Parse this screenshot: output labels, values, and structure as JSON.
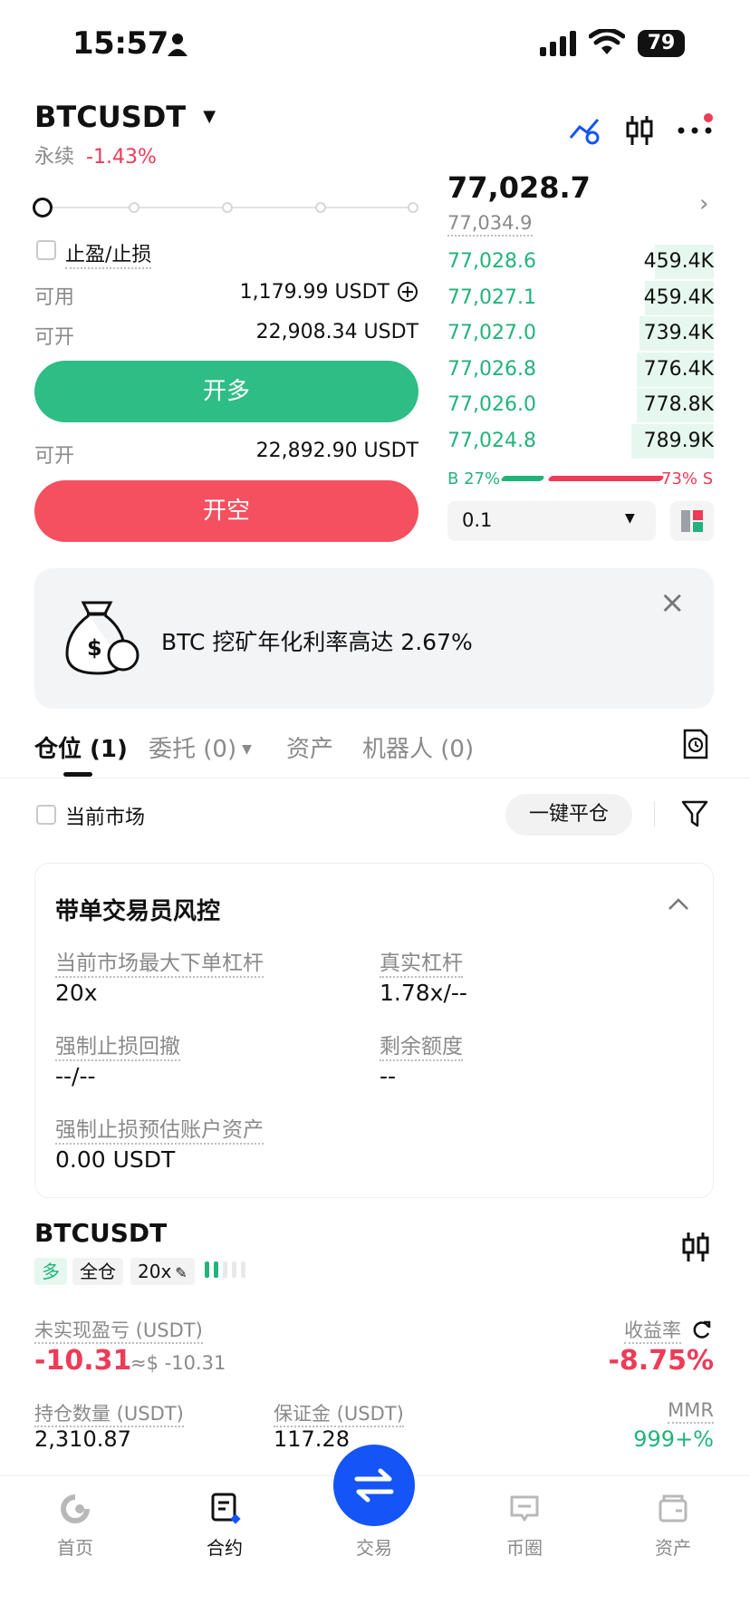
{
  "status_bar": {
    "time": "15:57",
    "battery": "79"
  },
  "header": {
    "pair": "BTCUSDT",
    "contract_type": "永续",
    "change": "-1.43%"
  },
  "order_form": {
    "tp_sl_label": "止盈/止损",
    "available_label": "可用",
    "available_value": "1,179.99 USDT",
    "open_label_1": "可开",
    "open_value_1": "22,908.34 USDT",
    "long_button": "开多",
    "open_label_2": "可开",
    "open_value_2": "22,892.90 USDT",
    "short_button": "开空"
  },
  "orderbook": {
    "last_price": "77,028.7",
    "mark_price": "77,034.9",
    "bids": [
      {
        "price": "77,028.6",
        "size": "459.4K",
        "depth": 0.22
      },
      {
        "price": "77,027.1",
        "size": "459.4K",
        "depth": 0.26
      },
      {
        "price": "77,027.0",
        "size": "739.4K",
        "depth": 0.28
      },
      {
        "price": "77,026.8",
        "size": "776.4K",
        "depth": 0.29
      },
      {
        "price": "77,026.0",
        "size": "778.8K",
        "depth": 0.29
      },
      {
        "price": "77,024.8",
        "size": "789.9K",
        "depth": 0.31
      }
    ],
    "buy_ratio": "B 27%",
    "sell_ratio": "73% S",
    "buy_fraction": 0.27,
    "precision": "0.1"
  },
  "banner": {
    "text": "BTC 挖矿年化利率高达 2.67%"
  },
  "tabs": [
    {
      "label": "仓位 (1)"
    },
    {
      "label": "委托 (0)"
    },
    {
      "label": "资产"
    },
    {
      "label": "机器人 (0)"
    }
  ],
  "filter": {
    "current_market_label": "当前市场",
    "close_all_button": "一键平仓"
  },
  "risk_card": {
    "title": "带单交易员风控",
    "max_leverage_label": "当前市场最大下单杠杆",
    "max_leverage_value": "20x",
    "real_leverage_label": "真实杠杆",
    "real_leverage_value": "1.78x/--",
    "forced_sl_drawdown_label": "强制止损回撤",
    "forced_sl_drawdown_value": "--/--",
    "remaining_quota_label": "剩余额度",
    "remaining_quota_value": "--",
    "forced_sl_assets_label": "强制止损预估账户资产",
    "forced_sl_assets_value": "0.00 USDT"
  },
  "position": {
    "pair": "BTCUSDT",
    "side_tag": "多",
    "margin_tag": "全仓",
    "leverage_tag": "20x",
    "upnl_label": "未实现盈亏 (USDT)",
    "upnl_value": "-10.31",
    "upnl_usd": "≈$ -10.31",
    "roe_label": "收益率",
    "roe_value": "-8.75%",
    "size_label": "持仓数量 (USDT)",
    "size_value": "2,310.87",
    "margin_label": "保证金 (USDT)",
    "margin_value": "117.28",
    "mmr_label": "MMR",
    "mmr_value": "999+%"
  },
  "bottom_nav": [
    {
      "label": "首页"
    },
    {
      "label": "合约"
    },
    {
      "label": "交易"
    },
    {
      "label": "币圈"
    },
    {
      "label": "资产"
    }
  ],
  "colors": {
    "green": "#22b37a",
    "red": "#ee3b57",
    "blue": "#1554f6"
  }
}
